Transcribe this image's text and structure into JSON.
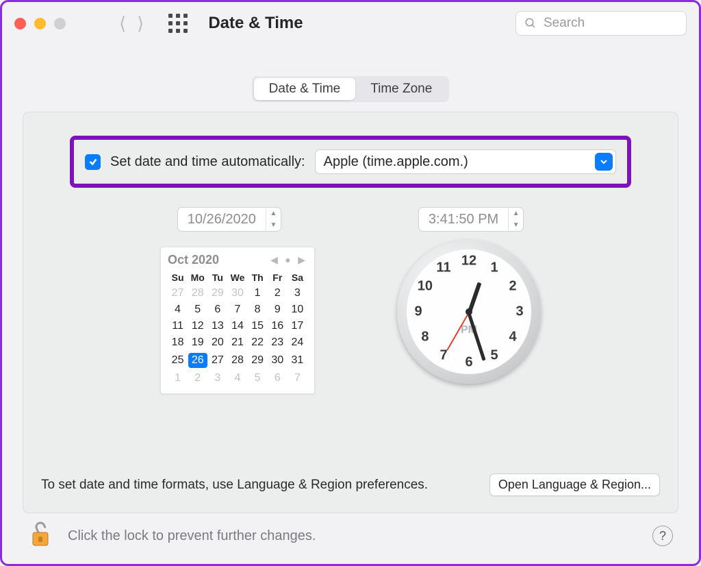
{
  "toolbar": {
    "title": "Date & Time",
    "search_placeholder": "Search"
  },
  "tabs": {
    "date_time": "Date & Time",
    "time_zone": "Time Zone"
  },
  "auto": {
    "label": "Set date and time automatically:",
    "server": "Apple (time.apple.com.)"
  },
  "date_field": "10/26/2020",
  "time_field": "3:41:50 PM",
  "calendar": {
    "month": "Oct 2020",
    "days": [
      "Su",
      "Mo",
      "Tu",
      "We",
      "Th",
      "Fr",
      "Sa"
    ],
    "rows": [
      [
        {
          "d": "27",
          "m": true
        },
        {
          "d": "28",
          "m": true
        },
        {
          "d": "29",
          "m": true
        },
        {
          "d": "30",
          "m": true
        },
        {
          "d": "1"
        },
        {
          "d": "2"
        },
        {
          "d": "3"
        }
      ],
      [
        {
          "d": "4"
        },
        {
          "d": "5"
        },
        {
          "d": "6"
        },
        {
          "d": "7"
        },
        {
          "d": "8"
        },
        {
          "d": "9"
        },
        {
          "d": "10"
        }
      ],
      [
        {
          "d": "11"
        },
        {
          "d": "12"
        },
        {
          "d": "13"
        },
        {
          "d": "14"
        },
        {
          "d": "15"
        },
        {
          "d": "16"
        },
        {
          "d": "17"
        }
      ],
      [
        {
          "d": "18"
        },
        {
          "d": "19"
        },
        {
          "d": "20"
        },
        {
          "d": "21"
        },
        {
          "d": "22"
        },
        {
          "d": "23"
        },
        {
          "d": "24"
        }
      ],
      [
        {
          "d": "25"
        },
        {
          "d": "26",
          "sel": true
        },
        {
          "d": "27"
        },
        {
          "d": "28"
        },
        {
          "d": "29"
        },
        {
          "d": "30"
        },
        {
          "d": "31"
        }
      ],
      [
        {
          "d": "1",
          "m": true
        },
        {
          "d": "2",
          "m": true
        },
        {
          "d": "3",
          "m": true
        },
        {
          "d": "4",
          "m": true
        },
        {
          "d": "5",
          "m": true
        },
        {
          "d": "6",
          "m": true
        },
        {
          "d": "7",
          "m": true
        }
      ]
    ]
  },
  "clock": {
    "numbers": [
      "12",
      "1",
      "2",
      "3",
      "4",
      "5",
      "6",
      "7",
      "8",
      "9",
      "10",
      "11"
    ],
    "ampm": "PM",
    "hour_angle": 19,
    "minute_angle": 162,
    "second_angle": 210
  },
  "footer_hint": "To set date and time formats, use Language & Region preferences.",
  "open_button": "Open Language & Region...",
  "lock_text": "Click the lock to prevent further changes.",
  "help_label": "?"
}
